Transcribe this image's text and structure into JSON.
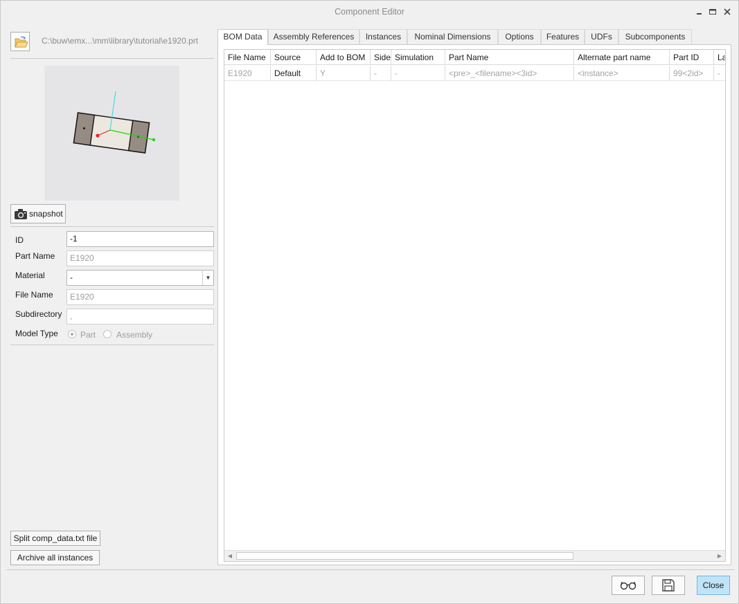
{
  "window": {
    "title": "Component Editor"
  },
  "left": {
    "path": "C:\\buw\\emx...\\mm\\library\\tutorial\\e1920.prt",
    "snapshot_label": "snapshot",
    "form": {
      "id_label": "ID",
      "id_value": "-1",
      "part_name_label": "Part Name",
      "part_name_value": "E1920",
      "material_label": "Material",
      "material_value": "-",
      "file_name_label": "File Name",
      "file_name_value": "E1920",
      "subdirectory_label": "Subdirectory",
      "subdirectory_value": ",",
      "model_type_label": "Model Type",
      "model_type_options": [
        "Part",
        "Assembly"
      ],
      "model_type_selected": "Part"
    },
    "split_label": "Split comp_data.txt file",
    "archive_label": "Archive all instances"
  },
  "tabs": [
    {
      "label": "BOM Data",
      "active": true
    },
    {
      "label": "Assembly References"
    },
    {
      "label": "Instances"
    },
    {
      "label": "Nominal Dimensions"
    },
    {
      "label": "Options"
    },
    {
      "label": "Features"
    },
    {
      "label": "UDFs"
    },
    {
      "label": "Subcomponents"
    }
  ],
  "bom_table": {
    "columns": [
      "File Name",
      "Source",
      "Add to BOM",
      "Side",
      "Simulation",
      "Part Name",
      "Alternate part name",
      "Part ID",
      "La"
    ],
    "rows": [
      [
        "E1920",
        "Default",
        "Y",
        "-",
        "-",
        "<pre>_<filename><3id>",
        "<instance>",
        "99<2id>",
        "-"
      ]
    ]
  },
  "footer": {
    "close_label": "Close"
  },
  "colors": {
    "accent": "#bfe3f7",
    "x_axis": "#1fd600",
    "y_axis": "#2fd5e0",
    "z_axis": "#e8252f"
  }
}
